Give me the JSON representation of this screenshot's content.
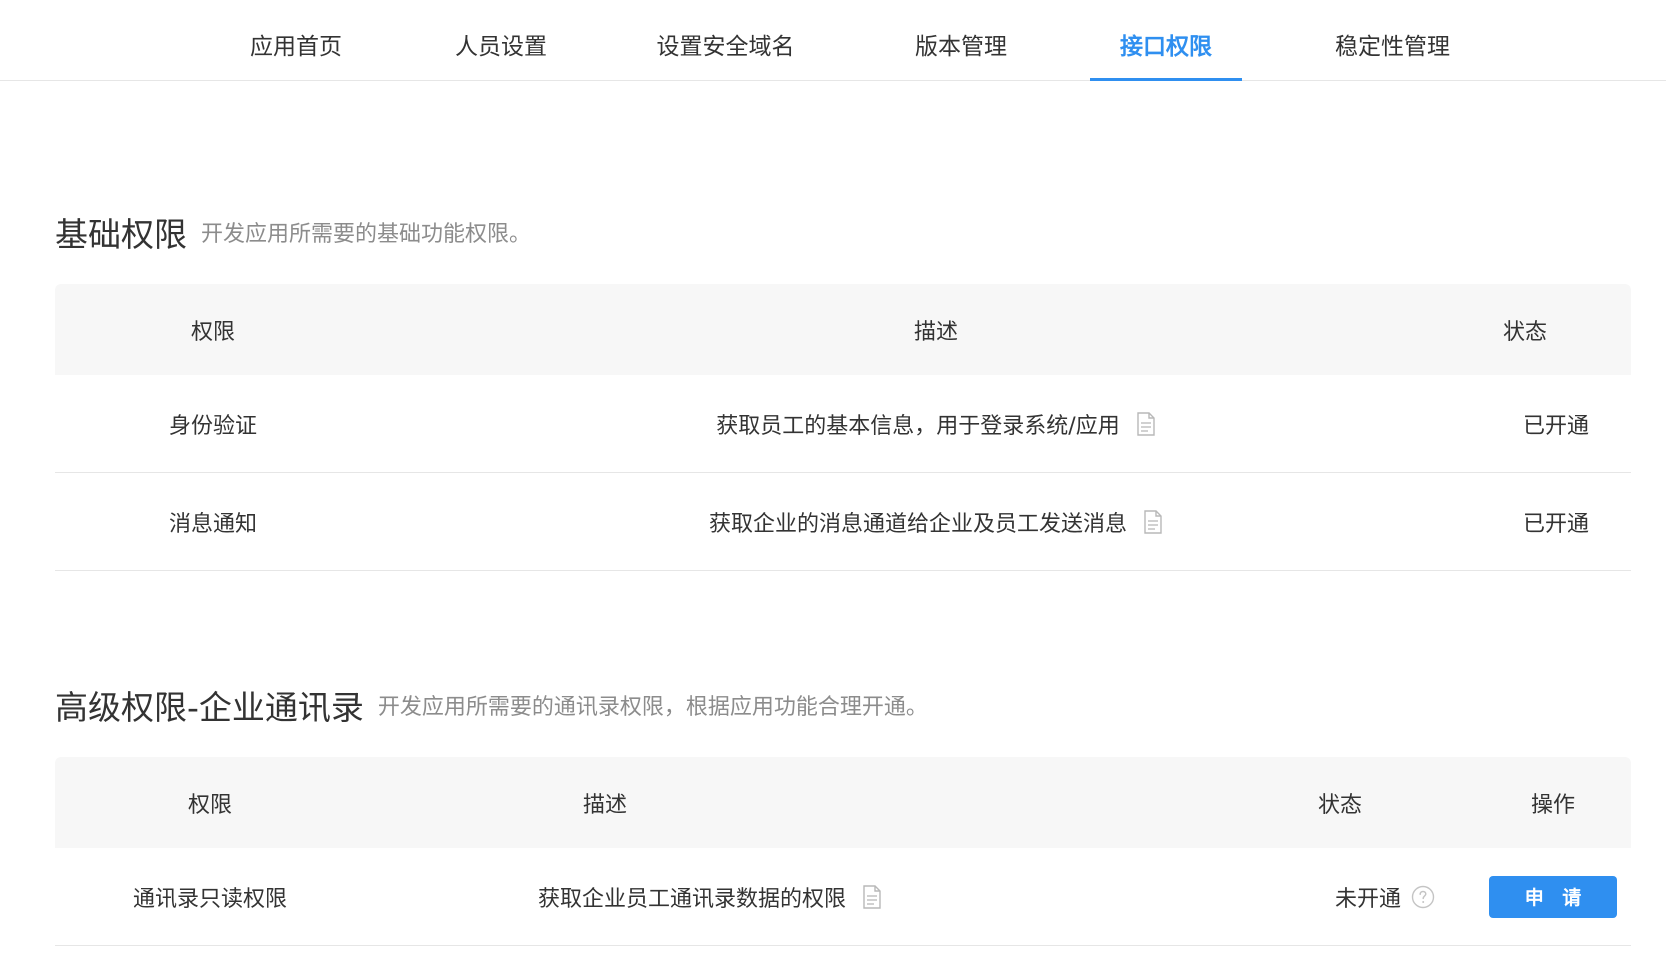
{
  "nav": {
    "tabs": [
      {
        "label": "应用首页"
      },
      {
        "label": "人员设置"
      },
      {
        "label": "设置安全域名"
      },
      {
        "label": "版本管理"
      },
      {
        "label": "接口权限"
      },
      {
        "label": "稳定性管理"
      }
    ],
    "active_index": 4,
    "accent_color": "#2f8ff0"
  },
  "basic": {
    "title": "基础权限",
    "subtitle": "开发应用所需要的基础功能权限。",
    "columns": {
      "permission": "权限",
      "description": "描述",
      "status": "状态"
    },
    "rows": [
      {
        "permission": "身份验证",
        "description": "获取员工的基本信息，用于登录系统/应用",
        "doc_icon": "document-icon",
        "status": "已开通"
      },
      {
        "permission": "消息通知",
        "description": "获取企业的消息通道给企业及员工发送消息",
        "doc_icon": "document-icon",
        "status": "已开通"
      }
    ]
  },
  "advanced": {
    "title": "高级权限-企业通讯录",
    "subtitle": "开发应用所需要的通讯录权限，根据应用功能合理开通。",
    "columns": {
      "permission": "权限",
      "description": "描述",
      "status": "状态",
      "action": "操作"
    },
    "rows": [
      {
        "permission": "通讯录只读权限",
        "description": "获取企业员工通讯录数据的权限",
        "doc_icon": "document-icon",
        "status": "未开通",
        "help_icon": "question-circle-icon",
        "action_label": "申 请"
      }
    ]
  }
}
